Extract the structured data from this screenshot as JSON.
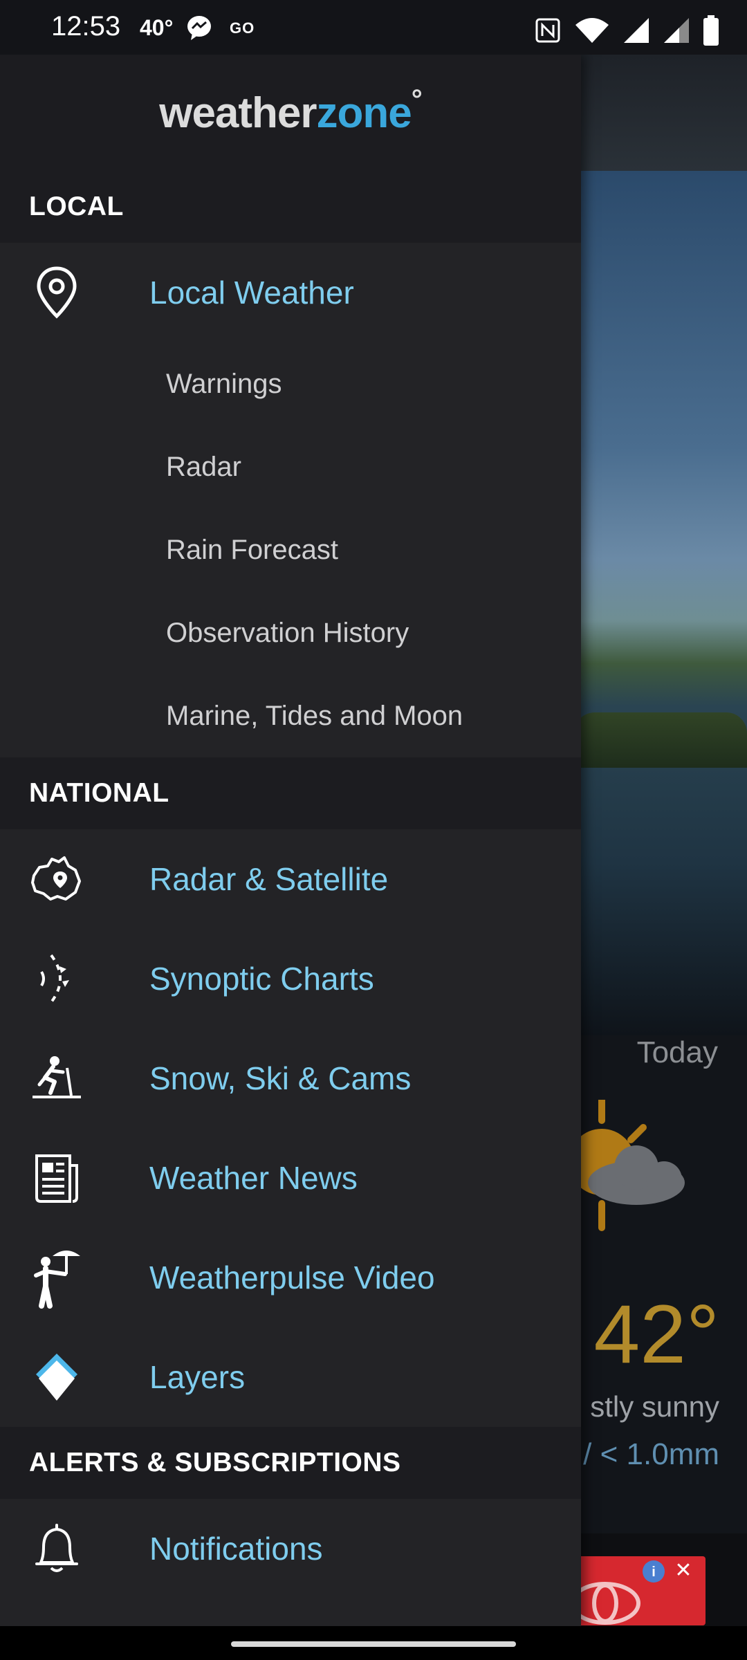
{
  "status_bar": {
    "time": "12:53",
    "temperature": "40°",
    "go_label": "GO"
  },
  "background": {
    "today_label": "Today",
    "temperature": "42°",
    "description": "stly sunny",
    "rain": "/ < 1.0mm"
  },
  "drawer": {
    "logo": {
      "part1": "weather",
      "part2": "zone",
      "degree": "°"
    },
    "sections": {
      "local": {
        "title": "LOCAL",
        "main_item": {
          "label": "Local Weather",
          "icon": "location-pin-icon"
        },
        "sub_items": [
          "Warnings",
          "Radar",
          "Rain Forecast",
          "Observation History",
          "Marine, Tides and Moon"
        ]
      },
      "national": {
        "title": "NATIONAL",
        "items": [
          {
            "label": "Radar & Satellite",
            "icon": "australia-map-icon"
          },
          {
            "label": "Synoptic Charts",
            "icon": "synoptic-front-icon"
          },
          {
            "label": "Snow, Ski & Cams",
            "icon": "skier-icon"
          },
          {
            "label": "Weather News",
            "icon": "news-article-icon"
          },
          {
            "label": "Weatherpulse Video",
            "icon": "person-umbrella-icon"
          },
          {
            "label": "Layers",
            "icon": "layers-icon"
          }
        ]
      },
      "alerts": {
        "title": "ALERTS & SUBSCRIPTIONS",
        "items": [
          {
            "label": "Notifications",
            "icon": "bell-icon"
          }
        ]
      }
    }
  },
  "colors": {
    "accent": "#7fcdee",
    "drawer_bg": "#232326",
    "section_bg": "#1c1c20",
    "logo_blue": "#3aa7dc"
  }
}
